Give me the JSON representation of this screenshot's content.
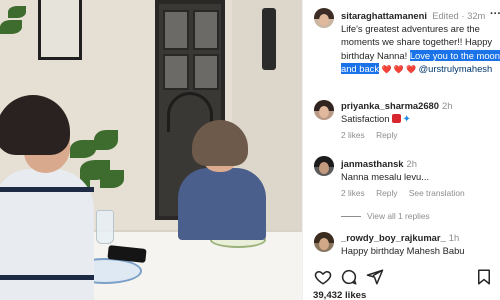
{
  "post": {
    "username": "sitaraghattamaneni",
    "edited_label": "Edited",
    "time": "32m",
    "caption_text": "Life's greatest adventures are the moments we share together!! Happy birthday Nanna!",
    "caption_highlight_1": "Love you to the moon",
    "caption_highlight_2": "and back",
    "caption_mention": "@urstrulymahesh",
    "more_label": "···"
  },
  "comments": [
    {
      "username": "priyanka_sharma2680",
      "time": "2h",
      "text": "Satisfaction",
      "likes": "2 likes",
      "reply": "Reply",
      "translation": ""
    },
    {
      "username": "janmasthansk",
      "time": "2h",
      "text": "Nanna mesalu levu...",
      "likes": "2 likes",
      "reply": "Reply",
      "translation": "See translation",
      "view_replies": "View all 1 replies"
    },
    {
      "username": "_rowdy_boy_rajkumar_",
      "time": "1h",
      "text": "Happy birthday Mahesh Babu",
      "likes": "",
      "reply": "",
      "translation": ""
    }
  ],
  "actions": {
    "like_icon": "heart-icon",
    "comment_icon": "comment-icon",
    "share_icon": "share-icon",
    "save_icon": "bookmark-icon"
  },
  "likes_count": "39,432 likes",
  "colors": {
    "highlight": "#1a73e8",
    "text": "#262626",
    "muted": "#8e8e8e",
    "heart": "#e0245e"
  }
}
